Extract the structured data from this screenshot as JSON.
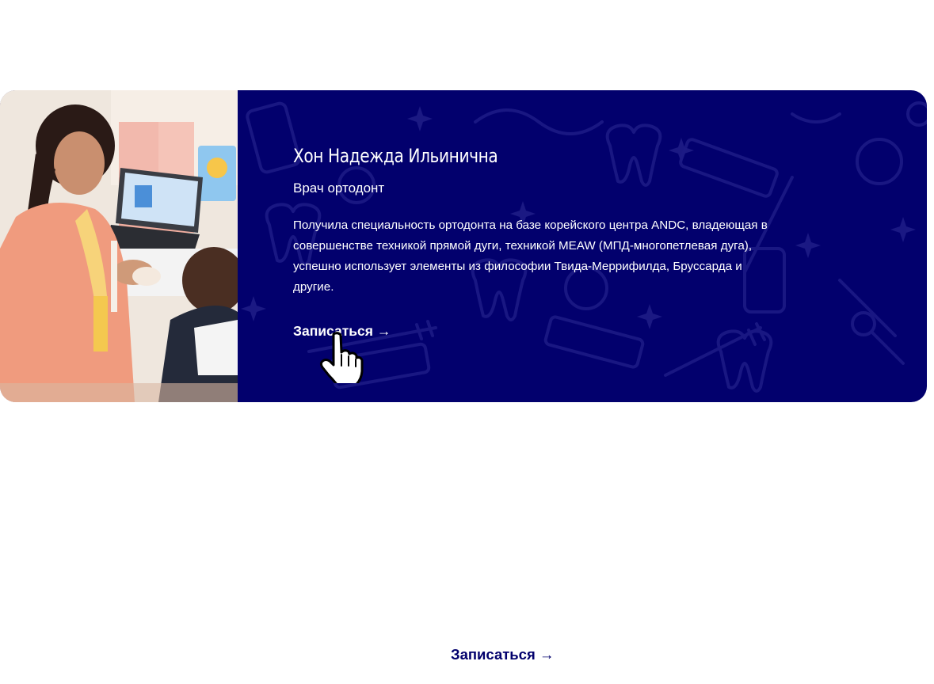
{
  "doctor": {
    "name": "Хон Надежда Ильинична",
    "role": "Врач ортодонт",
    "bio": "Получила специальность ортодонта на базе корейского центра ANDC, владеющая в совершенстве техникой прямой дуги, техникой MEAW (МПД-многопетлевая дуга), успешно использует элементы из философии Твида-Меррифилда, Бруссарда и другие.",
    "photo_icon": "doctor-photo",
    "cta_label": "Записаться →"
  },
  "footer": {
    "cta_label": "Записаться →"
  },
  "colors": {
    "card_background": "#02006d",
    "accent": "#02006d",
    "text_on_card": "#ffffff"
  },
  "cursor_icon": "hand-pointer-icon"
}
